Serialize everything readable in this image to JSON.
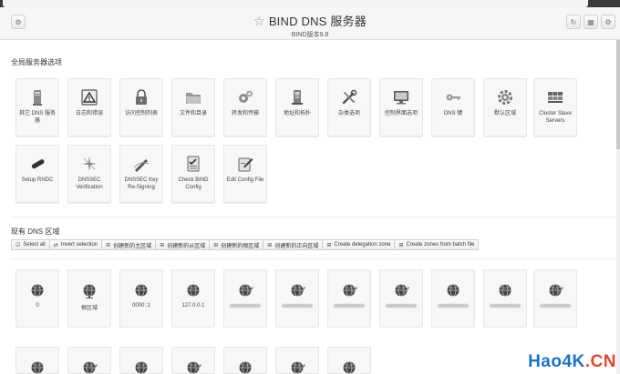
{
  "header": {
    "title": "BIND DNS 服务器",
    "subtitle": "BIND版本9.8",
    "left_icon": "gear-icon",
    "right_icons": [
      "refresh-icon",
      "grid-icon",
      "gear-icon"
    ]
  },
  "global_section": {
    "heading": "全局服务器选项",
    "items": [
      {
        "label": "其它 DNS 服务器",
        "icon": "server-icon"
      },
      {
        "label": "日志和错误",
        "icon": "warning-icon"
      },
      {
        "label": "访问控制列表",
        "icon": "lock-icon"
      },
      {
        "label": "文件和目录",
        "icon": "folder-icon"
      },
      {
        "label": "转发和传输",
        "icon": "gears-icon"
      },
      {
        "label": "地址和拓扑",
        "icon": "tower-icon"
      },
      {
        "label": "杂类选项",
        "icon": "tools-icon"
      },
      {
        "label": "控制界面选项",
        "icon": "monitor-icon"
      },
      {
        "label": "DNS 键",
        "icon": "key-icon"
      },
      {
        "label": "默认区域",
        "icon": "cog-icon"
      },
      {
        "label": "Cluster Slave Servers",
        "icon": "cluster-icon"
      },
      {
        "label": "Setup RNDC",
        "icon": "remote-icon"
      },
      {
        "label": "DNSSEC Verification",
        "icon": "sparkle-icon"
      },
      {
        "label": "DNSSEC Key Re-Signing",
        "icon": "pen-icon"
      },
      {
        "label": "Check BIND Config",
        "icon": "checklist-icon"
      },
      {
        "label": "Edit Config File",
        "icon": "edit-icon"
      }
    ]
  },
  "zones_section": {
    "heading": "现有 DNS 区域",
    "toolbar": [
      {
        "label": "Select all",
        "glyph": "☑"
      },
      {
        "label": "Invert selection",
        "glyph": "⇄"
      },
      {
        "label": "创建新的主区域",
        "glyph": "⊞"
      },
      {
        "label": "创建新的从区域",
        "glyph": "⊞"
      },
      {
        "label": "创建新的根区域",
        "glyph": "⊞"
      },
      {
        "label": "创建新的正向区域",
        "glyph": "⊞"
      },
      {
        "label": "Create delegation zone",
        "glyph": "⊞"
      },
      {
        "label": "Create zones from batch file",
        "glyph": "⊞"
      }
    ],
    "zones": [
      {
        "label": "0",
        "icon": "globe-icon"
      },
      {
        "label": "根区域",
        "icon": "globe-stand-icon"
      },
      {
        "label": "0000::1",
        "icon": "globe-icon"
      },
      {
        "label": "127.0.0.1",
        "icon": "globe-icon"
      },
      {
        "label": "",
        "icon": "globe-pen-icon"
      },
      {
        "label": "",
        "icon": "globe-pen-icon"
      },
      {
        "label": "",
        "icon": "globe-pen-icon"
      },
      {
        "label": "",
        "icon": "globe-pen-icon"
      },
      {
        "label": "",
        "icon": "globe-icon"
      },
      {
        "label": "",
        "icon": "globe-icon"
      },
      {
        "label": "",
        "icon": "globe-pen-icon"
      }
    ],
    "zones_row2_count_visible": 7
  },
  "watermark": {
    "part1": "Hao4K",
    "part2": ".CN"
  }
}
